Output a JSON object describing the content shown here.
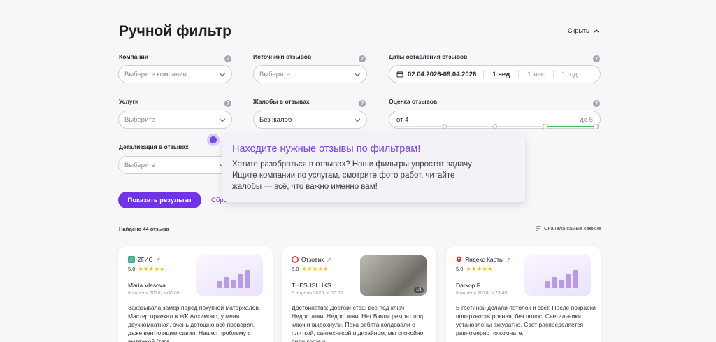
{
  "page": {
    "title": "Ручной фильтр",
    "hide_label": "Скрыть"
  },
  "filters": {
    "companies": {
      "label": "Компании",
      "placeholder": "Выберите компании"
    },
    "sources": {
      "label": "Источники отзывов",
      "placeholder": "Выберите"
    },
    "dates": {
      "label": "Даты оставления отзывов",
      "range": "02.04.2026-09.04.2026",
      "presets": [
        "1 нед",
        "1 мес",
        "1 год"
      ]
    },
    "services": {
      "label": "Услуги",
      "placeholder": "Выберите"
    },
    "complaints": {
      "label": "Жалобы в отзывах",
      "value": "Без жалоб"
    },
    "rating": {
      "label": "Оценка отзывов",
      "from": "от 4",
      "to": "до 5",
      "range_fraction": [
        0.75,
        1.0
      ]
    },
    "detail": {
      "label": "Детализация в отзывах",
      "placeholder": "Выберите"
    },
    "help_glyph": "?"
  },
  "actions": {
    "show_result": "Показать результат",
    "reset": "Сбро"
  },
  "results": {
    "found": "Найдено 44 отзыва",
    "sort": "Сначала самые свежие"
  },
  "tooltip": {
    "title": "Находите нужные отзывы по фильтрам!",
    "line1": "Хотите разобраться в отзывах? Наши фильтры упростят задачу!",
    "line2": "Ищите компании по услугам, смотрите фото работ, читайте",
    "line3": "жалобы — всё, что важно именно вам!"
  },
  "reviews": [
    {
      "source": "2ГИС",
      "rating": "5.0",
      "stars": "★★★★★",
      "author": "Maria Vlasova",
      "date": "6 апреля 2026, в 00:00",
      "text": "Заказывала замер перед покупкой материалов. Мастер приехал в ЖК Алхимово, у меня двухкомнатная, очень дотошно всё проверял, даже вентиляцию сдвил. Нашел проблему с вытяжкой (тяга"
    },
    {
      "source": "Отзовик",
      "rating": "5.0",
      "stars": "★★★★★",
      "author": "THESUSLUKS",
      "date": "6 апреля 2026, в 00:00",
      "photo_badge": "1/1",
      "text": "Достоинства: Достоинства: все под ключ Недостатки: Недостатки: Нет Взяли ремонт под ключ и выдохнули. Пока ребята колдовали с плиткой, сантехникой и дизайном, мы спокойно пили кофе и"
    },
    {
      "source": "Яндекс Карты",
      "rating": "5.0",
      "stars": "★★★★★",
      "author": "Darkop F",
      "date": "6 апреля 2026, в 23:45",
      "text": "В гостиной делали потолок и свет. После покраски поверхность ровная, без полос. Светильники установлены аккуратно. Свет распределяется равномерно по комнате."
    }
  ],
  "colors": {
    "accent": "#7033e8",
    "star": "#f5b400",
    "range": "#3dbb5a"
  }
}
